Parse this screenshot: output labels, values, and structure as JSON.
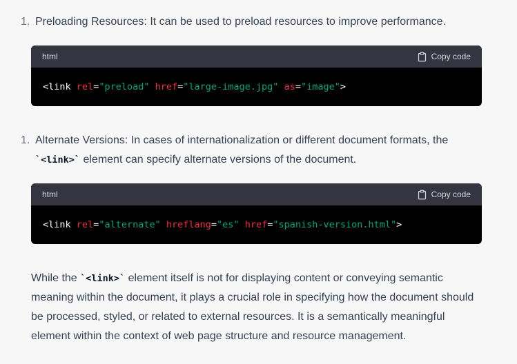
{
  "item1": {
    "number": "1.",
    "title": "Preloading Resources:",
    "text": " It can be used to preload resources to improve performance."
  },
  "code1": {
    "language": "html",
    "copy_label": "Copy code",
    "tokens": {
      "open": "<link ",
      "attr1": "rel",
      "eq1": "=",
      "val1": "\"preload\"",
      "sp1": " ",
      "attr2": "href",
      "eq2": "=",
      "val2": "\"large-image.jpg\"",
      "sp2": " ",
      "attr3": "as",
      "eq3": "=",
      "val3": "\"image\"",
      "close": ">"
    }
  },
  "item2": {
    "number": "1.",
    "title": "Alternate Versions:",
    "text": " In cases of internationalization or different document formats, the",
    "line2_code": "`<link>`",
    "line2_text": " element can specify alternate versions of the document."
  },
  "code2": {
    "language": "html",
    "copy_label": "Copy code",
    "tokens": {
      "open": "<link ",
      "attr1": "rel",
      "eq1": "=",
      "val1": "\"alternate\"",
      "sp1": " ",
      "attr2": "hreflang",
      "eq2": "=",
      "val2": "\"es\"",
      "sp2": " ",
      "attr3": "href",
      "eq3": "=",
      "val3": "\"spanish-version.html\"",
      "close": ">"
    }
  },
  "paragraph": {
    "pre": "While the ",
    "code": "`<link>`",
    "post": " element itself is not for displaying content or conveying semantic meaning within the document, it plays a crucial role in specifying how the document should be processed, styled, or related to external resources. It is a semantically meaningful element within the context of web page structure and resource management."
  },
  "colors": {
    "attribute": "#f22c3d",
    "string": "#00a67d",
    "code_bg": "#000000",
    "header_bg": "#343541"
  },
  "icons": {
    "copy": "clipboard-icon"
  }
}
